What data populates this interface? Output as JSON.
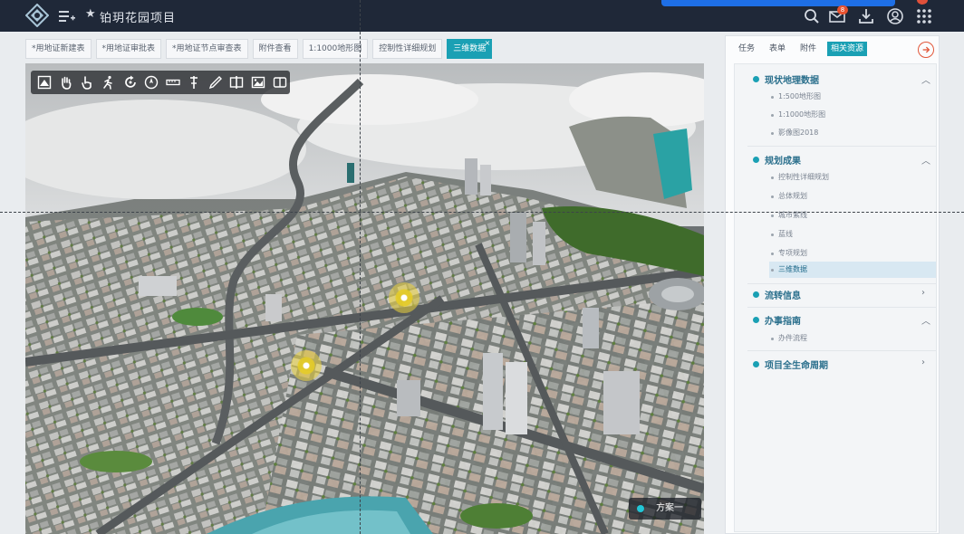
{
  "header": {
    "project_title": "铂玥花园项目",
    "notification_count": "8",
    "icons": [
      "app-logo-icon",
      "add-list-icon",
      "star-icon",
      "search-icon",
      "mail-icon",
      "download-icon",
      "user-icon",
      "apps-grid-icon"
    ]
  },
  "tabs": [
    {
      "label": "*用地证新建表",
      "active": false
    },
    {
      "label": "*用地证审批表",
      "active": false
    },
    {
      "label": "*用地证节点审查表",
      "active": false
    },
    {
      "label": "附件查看",
      "active": false
    },
    {
      "label": "1:1000地形图",
      "active": false
    },
    {
      "label": "控制性详细规划",
      "active": false
    },
    {
      "label": "三维数据",
      "active": true
    }
  ],
  "map": {
    "toolbar_icons": [
      "home-view-icon",
      "pan-hand-icon",
      "pointer-hand-icon",
      "walk-icon",
      "rotate-icon",
      "compass-icon",
      "measure-distance-icon",
      "measure-height-icon",
      "draw-line-icon",
      "split-view-icon",
      "image-layer-icon",
      "compare-icon"
    ],
    "scheme_label": "方案一",
    "colors": {
      "marker": "#e6cd28",
      "scheme_dot": "#22c6d6"
    }
  },
  "panel": {
    "tabs": [
      {
        "label": "任务",
        "active": false
      },
      {
        "label": "表单",
        "active": false
      },
      {
        "label": "附件",
        "active": false
      },
      {
        "label": "相关资源",
        "active": true
      }
    ],
    "sections": [
      {
        "label": "现状地理数据",
        "expanded": true,
        "items": [
          "1:500地形图",
          "1:1000地形图",
          "影像图2018"
        ]
      },
      {
        "label": "规划成果",
        "expanded": true,
        "items": [
          "控制性详细规划",
          "总体规划",
          "城市紫线",
          "蓝线",
          "专项规划",
          "三维数据"
        ]
      },
      {
        "label": "流转信息",
        "expanded": false,
        "items": []
      },
      {
        "label": "办事指南",
        "expanded": true,
        "items": [
          "办件流程"
        ]
      },
      {
        "label": "项目全生命周期",
        "expanded": false,
        "items": []
      }
    ],
    "selected_item": "三维数据",
    "colors": {
      "accent": "#1aa0b4",
      "arrow": "#e2573a"
    }
  }
}
